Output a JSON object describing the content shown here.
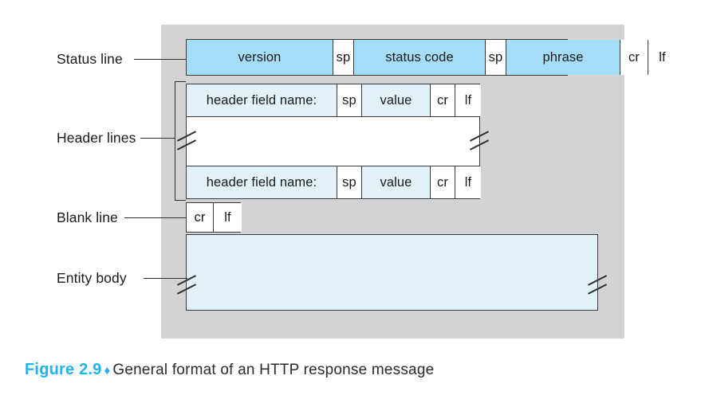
{
  "figure": {
    "label": "Figure 2.9",
    "separator": "♦",
    "caption": "General format of an HTTP response message"
  },
  "colors": {
    "panel_background": "#d2d3d4",
    "status_line_fill": "#a5dcf7",
    "header_field_fill": "#e1f2fb",
    "white_fill": "#ffffff",
    "border": "#3a3a3c",
    "accent": "#1eb4ef"
  },
  "labels": {
    "status_line": "Status line",
    "header_lines": "Header lines",
    "blank_line": "Blank line",
    "entity_body": "Entity body"
  },
  "message": {
    "status_line": {
      "name": "status-line",
      "cells": [
        {
          "text": "version",
          "fill": "blue"
        },
        {
          "text": "sp",
          "fill": "white"
        },
        {
          "text": "status code",
          "fill": "blue"
        },
        {
          "text": "sp",
          "fill": "white"
        },
        {
          "text": "phrase",
          "fill": "blue"
        },
        {
          "text": "cr",
          "fill": "white"
        },
        {
          "text": "lf",
          "fill": "white"
        }
      ]
    },
    "header_line_1": {
      "name": "header-line-first",
      "cells": [
        {
          "text": "header field name:",
          "fill": "palecyan"
        },
        {
          "text": "sp",
          "fill": "white"
        },
        {
          "text": "value",
          "fill": "palecyan"
        },
        {
          "text": "cr",
          "fill": "white"
        },
        {
          "text": "lf",
          "fill": "white"
        }
      ]
    },
    "header_line_2": {
      "name": "header-line-last",
      "cells": [
        {
          "text": "header field name:",
          "fill": "palecyan"
        },
        {
          "text": "sp",
          "fill": "white"
        },
        {
          "text": "value",
          "fill": "palecyan"
        },
        {
          "text": "cr",
          "fill": "white"
        },
        {
          "text": "lf",
          "fill": "white"
        }
      ]
    },
    "blank_line": {
      "name": "blank-line",
      "cells": [
        {
          "text": "cr",
          "fill": "white"
        },
        {
          "text": "lf",
          "fill": "white"
        }
      ]
    },
    "entity_body": {
      "name": "entity-body",
      "text": "",
      "fill": "palecyan"
    }
  }
}
